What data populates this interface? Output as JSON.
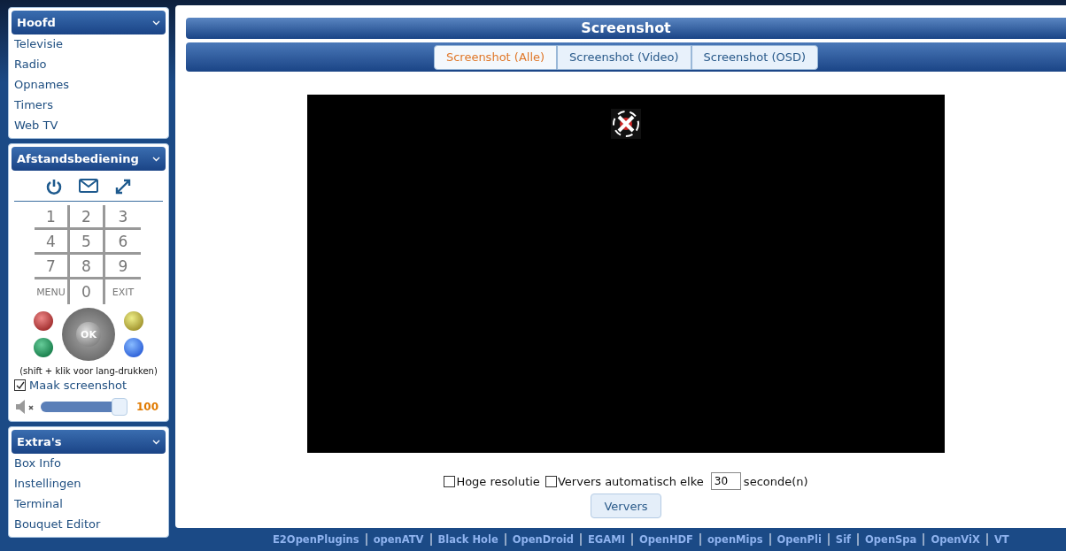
{
  "sidebar": {
    "panels": [
      {
        "kind": "menu",
        "title": "Hoofd",
        "items": [
          "Televisie",
          "Radio",
          "Opnames",
          "Timers",
          "Web TV"
        ]
      },
      {
        "kind": "remote",
        "title": "Afstandsbediening",
        "keys": [
          "1",
          "2",
          "3",
          "4",
          "5",
          "6",
          "7",
          "8",
          "9",
          "MENU",
          "0",
          "EXIT"
        ],
        "ok": "OK",
        "hint": "(shift + klik voor lang-drukken)",
        "screenshot_option": {
          "label": "Maak screenshot",
          "checked": true
        },
        "volume": {
          "level": 1.0,
          "reading": "100",
          "muted": true
        }
      },
      {
        "kind": "menu",
        "title": "Extra's",
        "items": [
          "Box Info",
          "Instellingen",
          "Terminal",
          "Bouquet Editor"
        ]
      }
    ]
  },
  "main": {
    "title": "Screenshot",
    "tabs": [
      {
        "label": "Screenshot (Alle)",
        "selected": true
      },
      {
        "label": "Screenshot (Video)",
        "selected": false
      },
      {
        "label": "Screenshot (OSD)",
        "selected": false
      }
    ],
    "options": {
      "high_res": {
        "label": "Hoge resolutie",
        "checked": false
      },
      "auto_refresh": {
        "label": "Ververs automatisch elke",
        "checked": false
      },
      "interval": "30",
      "unit": "seconde(n)"
    },
    "refresh_button": "Ververs"
  },
  "footer_links": [
    "E2OpenPlugins",
    "openATV",
    "Black Hole",
    "OpenDroid",
    "EGAMI",
    "OpenHDF",
    "openMips",
    "OpenPli",
    "Sif",
    "OpenSpa",
    "OpenViX",
    "VT"
  ]
}
